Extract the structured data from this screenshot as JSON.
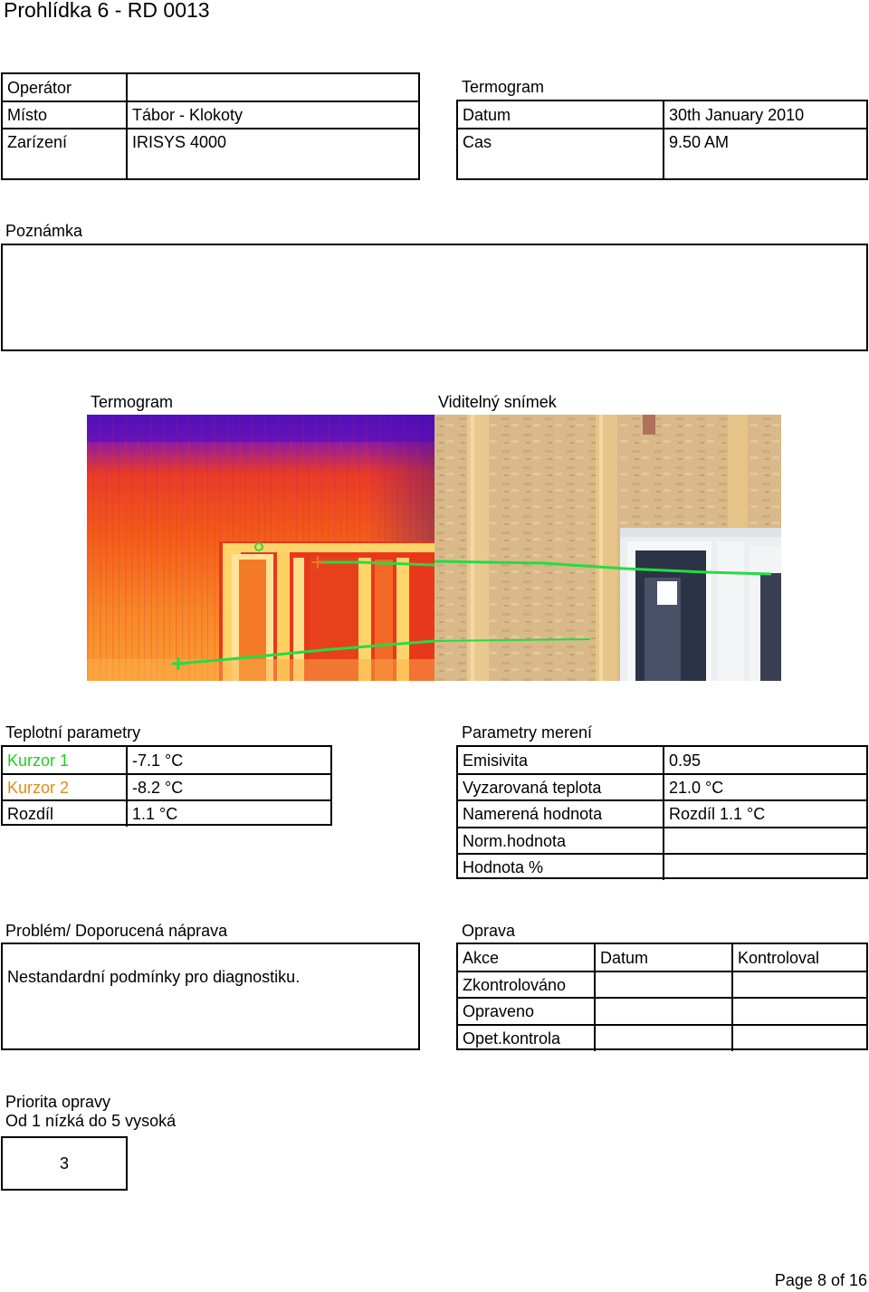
{
  "page_title": "Prohlídka 6 - RD 0013",
  "left_header": {
    "operator_label": "Operátor",
    "operator_value": "",
    "place_label": "Místo",
    "place_value": "Tábor - Klokoty",
    "device_label": "Zarízení",
    "device_value": "IRISYS 4000"
  },
  "right_header": {
    "title": "Termogram",
    "date_label": "Datum",
    "date_value": "30th January 2010",
    "time_label": "Cas",
    "time_value": "9.50 AM"
  },
  "note": {
    "label": "Poznámka",
    "value": ""
  },
  "images": {
    "thermo_label": "Termogram",
    "visible_label": "Viditelný snímek"
  },
  "temp_params": {
    "title": "Teplotní parametry",
    "rows": [
      {
        "label": "Kurzor 1",
        "value": "-7.1 °C",
        "color": "#1fd11f"
      },
      {
        "label": "Kurzor 2",
        "value": "-8.2 °C",
        "color": "#e88a14"
      },
      {
        "label": "Rozdíl",
        "value": "1.1 °C",
        "color": "#000000"
      }
    ]
  },
  "measure_params": {
    "title": "Parametry merení",
    "rows": [
      {
        "label": "Emisivita",
        "value": "0.95"
      },
      {
        "label": "Vyzarovaná teplota",
        "value": "21.0 °C"
      },
      {
        "label": "Namerená hodnota",
        "value": "Rozdíl 1.1 °C"
      },
      {
        "label": "Norm.hodnota",
        "value": ""
      },
      {
        "label": "Hodnota %",
        "value": ""
      }
    ]
  },
  "problem": {
    "title": "Problém/ Doporucená náprava",
    "text": "Nestandardní podmínky pro diagnostiku."
  },
  "repair": {
    "title": "Oprava",
    "headers": [
      "Akce",
      "Datum",
      "Kontroloval"
    ],
    "rows": [
      "Zkontrolováno",
      "Opraveno",
      "Opet.kontrola"
    ]
  },
  "priority": {
    "title": "Priorita opravy",
    "subtitle": "Od 1 nízká do 5 vysoká",
    "value": "3"
  },
  "footer": {
    "page": "Page 8 of 16"
  }
}
